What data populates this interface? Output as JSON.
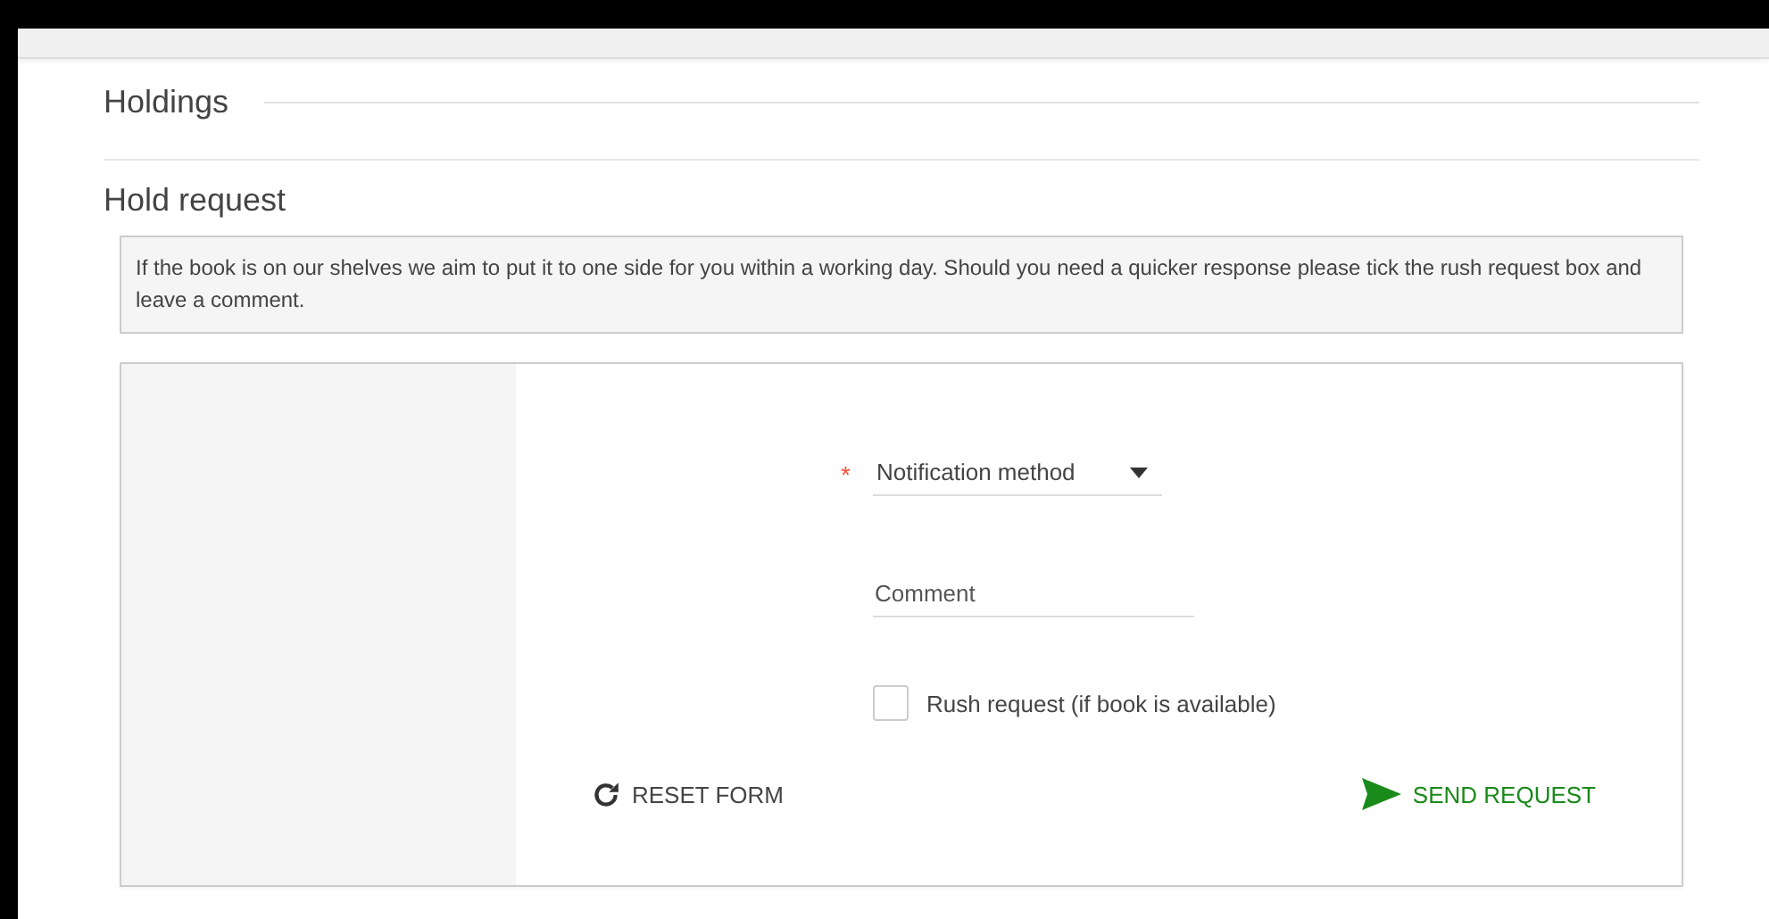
{
  "holdings": {
    "title": "Holdings"
  },
  "hold_request": {
    "title": "Hold request",
    "notice": "If the book is on our shelves we aim to put it to one side for you within a working day. Should you need a quicker response please tick the rush request box and leave a comment.",
    "form": {
      "notification": {
        "label": "Notification method",
        "required": true,
        "required_mark": "*"
      },
      "comment": {
        "placeholder": "Comment"
      },
      "rush": {
        "label": "Rush request (if book is available)",
        "checked": false
      },
      "buttons": [
        {
          "kind": "reset",
          "label": "RESET FORM"
        },
        {
          "kind": "send",
          "label": "SEND REQUEST"
        }
      ]
    }
  }
}
